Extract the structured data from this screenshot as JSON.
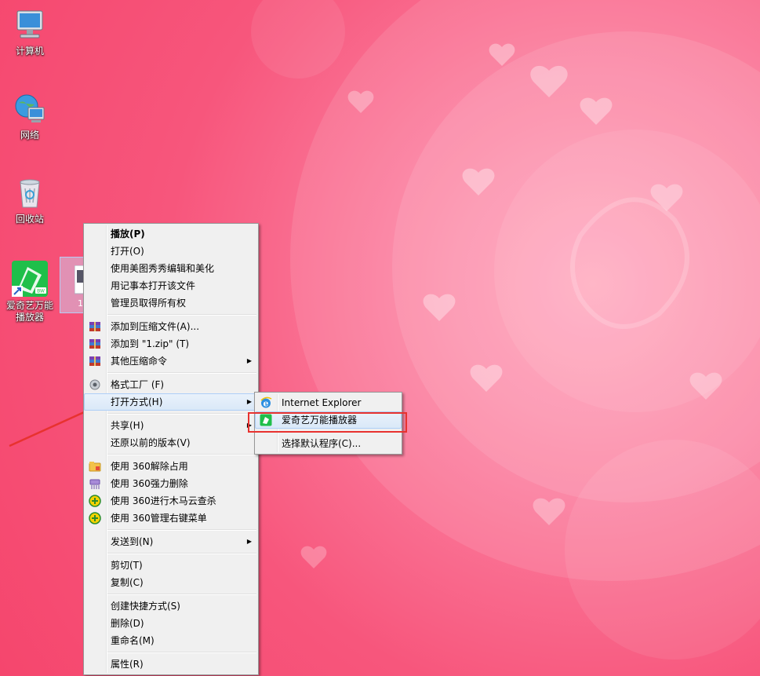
{
  "desktop": {
    "icons": [
      {
        "label": "计算机"
      },
      {
        "label": "网络"
      },
      {
        "label": "回收站"
      },
      {
        "label": "爱奇艺万能播放器",
        "badge": "BW"
      }
    ],
    "selected_file_label": "1"
  },
  "context_menu": {
    "items": [
      {
        "label": "播放(P)"
      },
      {
        "label": "打开(O)"
      },
      {
        "label": "使用美图秀秀编辑和美化"
      },
      {
        "label": "用记事本打开该文件"
      },
      {
        "label": "管理员取得所有权"
      },
      {
        "label": "添加到压缩文件(A)..."
      },
      {
        "label": "添加到 \"1.zip\" (T)"
      },
      {
        "label": "其他压缩命令"
      },
      {
        "label": "格式工厂 (F)"
      },
      {
        "label": "打开方式(H)"
      },
      {
        "label": "共享(H)"
      },
      {
        "label": "还原以前的版本(V)"
      },
      {
        "label": "使用 360解除占用"
      },
      {
        "label": "使用 360强力删除"
      },
      {
        "label": "使用 360进行木马云查杀"
      },
      {
        "label": "使用 360管理右键菜单"
      },
      {
        "label": "发送到(N)"
      },
      {
        "label": "剪切(T)"
      },
      {
        "label": "复制(C)"
      },
      {
        "label": "创建快捷方式(S)"
      },
      {
        "label": "删除(D)"
      },
      {
        "label": "重命名(M)"
      },
      {
        "label": "属性(R)"
      }
    ]
  },
  "open_with_submenu": {
    "items": [
      {
        "label": "Internet Explorer"
      },
      {
        "label": "爱奇艺万能播放器"
      },
      {
        "label": "选择默认程序(C)..."
      }
    ]
  },
  "colors": {
    "highlight_box": "#e8322f",
    "annotation_arrow": "#e8322f",
    "menu_bg": "#f0f0f0"
  },
  "icons": {
    "computer": "computer-icon",
    "network": "network-icon",
    "recycle_bin": "recycle-bin-icon",
    "player": "iqiyi-player-icon",
    "archive": "winrar-icon",
    "format_factory": "format-factory-icon",
    "ie": "internet-explorer-icon",
    "shield360": "360-icon"
  }
}
